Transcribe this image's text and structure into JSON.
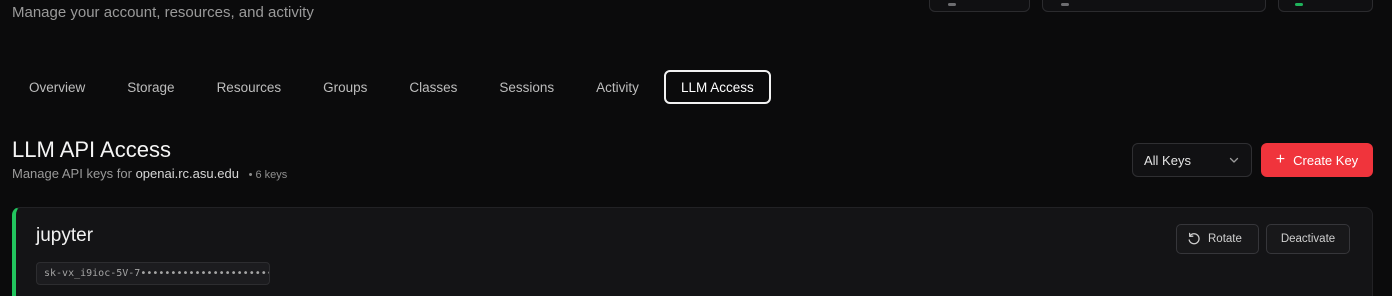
{
  "header": {
    "subtitle": "Manage your account, resources, and activity"
  },
  "tabs": [
    {
      "label": "Overview",
      "active": false
    },
    {
      "label": "Storage",
      "active": false
    },
    {
      "label": "Resources",
      "active": false
    },
    {
      "label": "Groups",
      "active": false
    },
    {
      "label": "Classes",
      "active": false
    },
    {
      "label": "Sessions",
      "active": false
    },
    {
      "label": "Activity",
      "active": false
    },
    {
      "label": "LLM Access",
      "active": true
    }
  ],
  "section": {
    "title": "LLM API Access",
    "subtitle_prefix": "Manage API keys for",
    "host": "openai.rc.asu.edu",
    "count": "• 6 keys"
  },
  "filter": {
    "selected": "All Keys",
    "icon": "chevron-down-icon"
  },
  "create_button": {
    "label": "Create Key",
    "icon": "plus-icon"
  },
  "keys": [
    {
      "name": "jupyter",
      "masked_key": "sk-vx_i9ioc-5V-7•••••••••••••••••••••••••••••…",
      "status_color": "#22c55e",
      "rotate_label": "Rotate",
      "deactivate_label": "Deactivate"
    }
  ],
  "colors": {
    "accent": "#f0343c",
    "active_status": "#22c55e",
    "background": "#0b0b0c"
  }
}
